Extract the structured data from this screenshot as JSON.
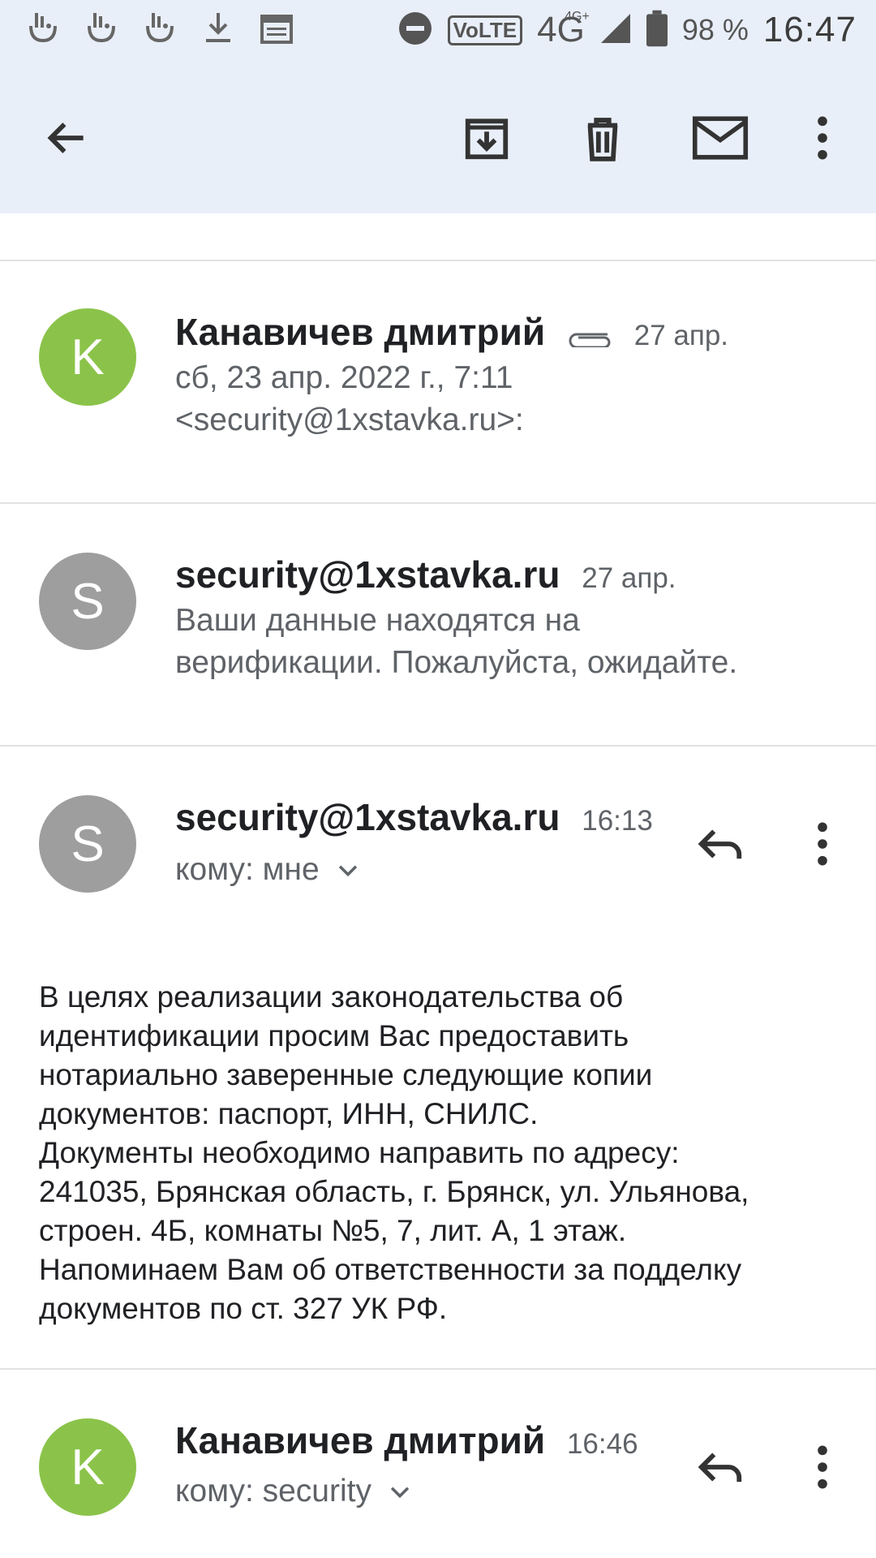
{
  "status_bar": {
    "battery_percent": "98 %",
    "time": "16:47",
    "network_label": "4G",
    "network_sup": "4G+",
    "volte_label": "VoLTE",
    "icons": [
      "notification-icon",
      "notification-icon",
      "notification-icon",
      "download-icon",
      "calendar-icon",
      "dnd-icon",
      "volte-icon",
      "signal-icon",
      "battery-icon"
    ]
  },
  "toolbar": {
    "icons": [
      "back-arrow-icon",
      "archive-icon",
      "delete-icon",
      "mark-unread-icon",
      "more-vert-icon"
    ]
  },
  "messages": [
    {
      "avatar_letter": "K",
      "avatar_color": "#8bc34a",
      "sender": "Канавичев дмитрий",
      "date": "27 апр.",
      "has_attachment": true,
      "snippet_lines": [
        "сб, 23 апр. 2022 г., 7:11",
        "<security@1xstavka.ru>:"
      ]
    },
    {
      "avatar_letter": "S",
      "avatar_color": "#9e9e9e",
      "sender": "security@1xstavka.ru",
      "date": "27 апр.",
      "snippet_lines": [
        "Ваши данные находятся на",
        "верификации. Пожалуйста, ожидайте."
      ]
    },
    {
      "avatar_letter": "S",
      "avatar_color": "#9e9e9e",
      "sender": "security@1xstavka.ru",
      "date": "16:13",
      "recipient": "кому: мне",
      "body_lines": [
        "В целях реализации законодательства об",
        "идентификации просим Вас предоставить",
        "нотариально заверенные следующие копии",
        "документов: паспорт, ИНН, СНИЛС.",
        "Документы необходимо направить по адресу:",
        "241035, Брянская область, г. Брянск, ул. Ульянова,",
        "строен. 4Б, комнаты №5, 7, лит. А, 1 этаж.",
        "Напоминаем Вам об ответственности за подделку",
        "документов по ст. 327 УК РФ."
      ]
    },
    {
      "avatar_letter": "K",
      "avatar_color": "#8bc34a",
      "sender": "Канавичев дмитрий",
      "date": "16:46",
      "recipient": "кому: security"
    }
  ]
}
